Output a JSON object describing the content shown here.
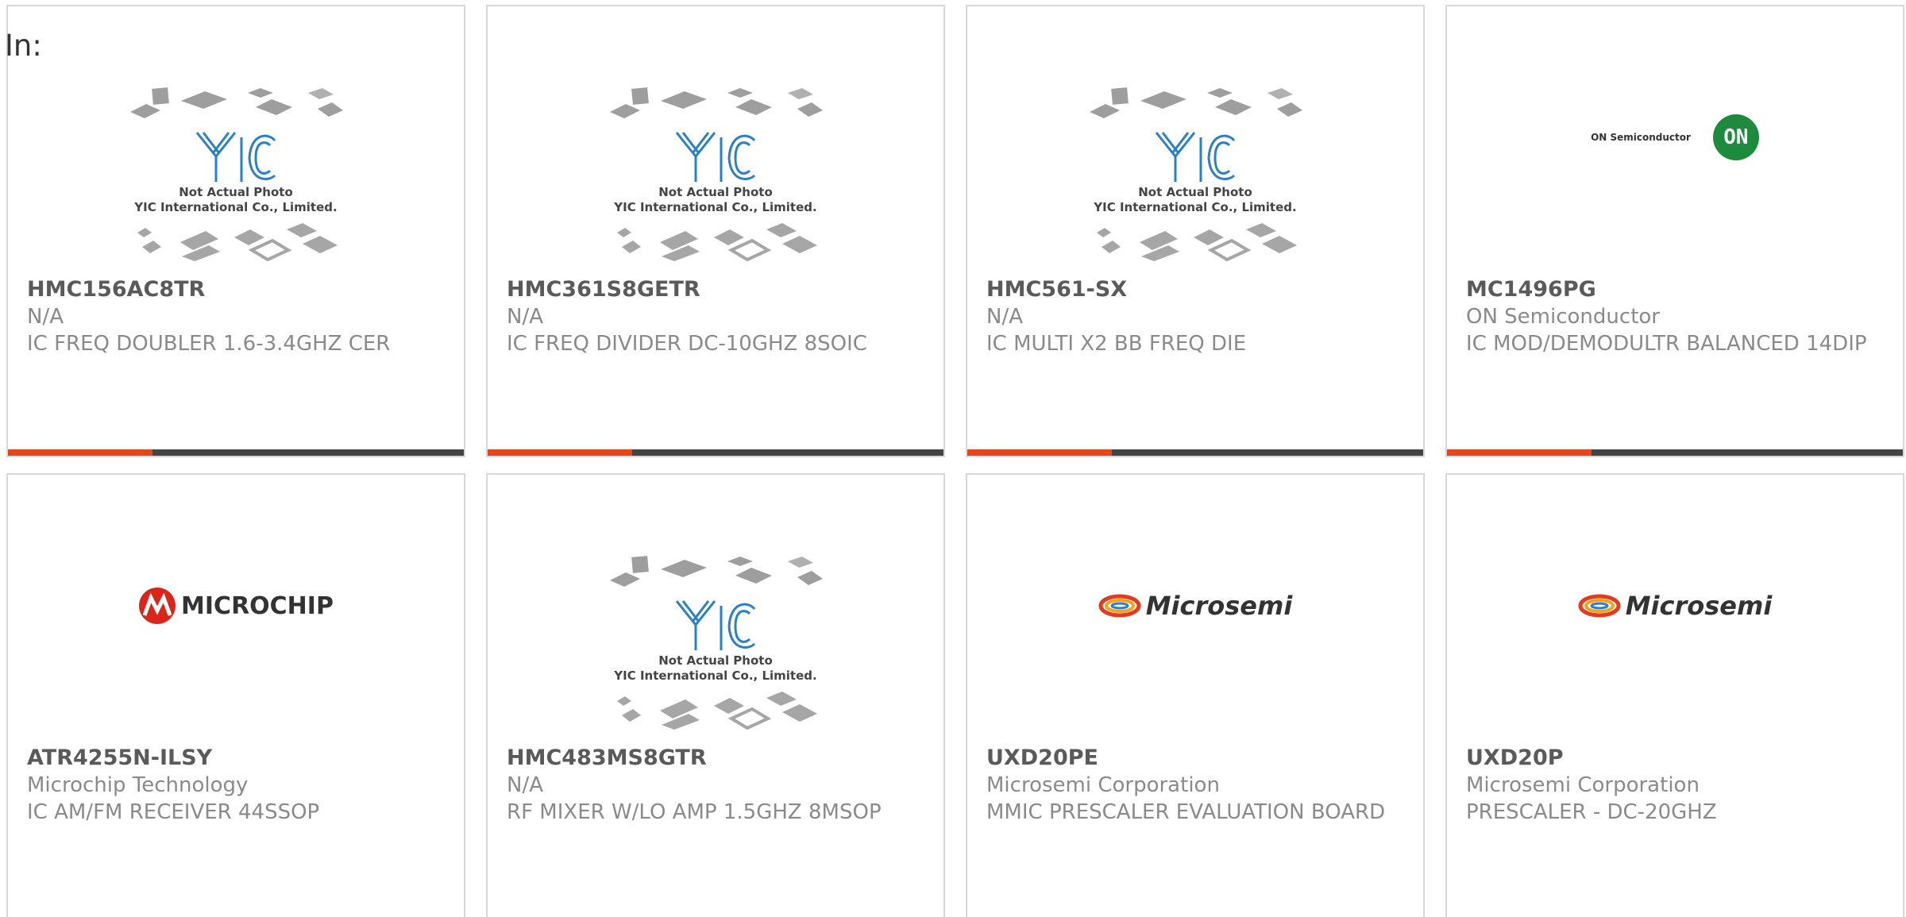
{
  "filter": {
    "label": "In:"
  },
  "placeholder_caption": {
    "line1": "Not Actual Photo",
    "line2": "YIC International Co., Limited."
  },
  "logos": {
    "on": {
      "text": "ON Semiconductor",
      "badge": "ON"
    },
    "microchip": {
      "text": "MICROCHIP"
    },
    "microsemi": {
      "text": "Microsemi"
    }
  },
  "colors": {
    "accent": "#e5461c",
    "bar": "#444444",
    "border": "#d8d8d8"
  },
  "products": [
    {
      "part": "HMC156AC8TR",
      "manufacturer": "N/A",
      "description": "IC FREQ DOUBLER 1.6-3.4GHZ CER",
      "image": "yic-placeholder"
    },
    {
      "part": "HMC361S8GETR",
      "manufacturer": "N/A",
      "description": "IC FREQ DIVIDER DC-10GHZ 8SOIC",
      "image": "yic-placeholder"
    },
    {
      "part": "HMC561-SX",
      "manufacturer": "N/A",
      "description": "IC MULTI X2 BB FREQ DIE",
      "image": "yic-placeholder"
    },
    {
      "part": "MC1496PG",
      "manufacturer": "ON Semiconductor",
      "description": "IC MOD/DEMODULTR BALANCED 14DIP",
      "image": "on-semiconductor-logo"
    },
    {
      "part": "ATR4255N-ILSY",
      "manufacturer": "Microchip Technology",
      "description": "IC AM/FM RECEIVER 44SSOP",
      "image": "microchip-logo"
    },
    {
      "part": "HMC483MS8GTR",
      "manufacturer": "N/A",
      "description": "RF MIXER W/LO AMP 1.5GHZ 8MSOP",
      "image": "yic-placeholder"
    },
    {
      "part": "UXD20PE",
      "manufacturer": "Microsemi Corporation",
      "description": "MMIC PRESCALER EVALUATION BOARD",
      "image": "microsemi-logo"
    },
    {
      "part": "UXD20P",
      "manufacturer": "Microsemi Corporation",
      "description": "PRESCALER - DC-20GHZ",
      "image": "microsemi-logo"
    }
  ]
}
